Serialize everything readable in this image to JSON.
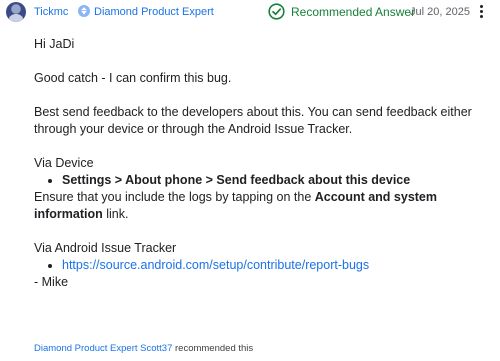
{
  "header": {
    "username": "Tickmc",
    "badge_label": "Diamond Product Expert",
    "status_label": "Recommended Answer",
    "date": "Jul 20, 2025",
    "more_icon": "more-vertical-icon",
    "status_color": "#188038",
    "link_color": "#1a73e8"
  },
  "post": {
    "greeting": "Hi JaDi",
    "confirm": "Good catch - I can confirm this bug.",
    "advice": "Best send feedback to the developers about this. You can send feedback either through your device or through the Android Issue Tracker.",
    "via_device_heading": "Via Device",
    "device_step": "Settings > About phone > Send feedback about this device",
    "ensure_prefix": "Ensure that you include the logs by tapping on the ",
    "ensure_bold": "Account and system information",
    "ensure_suffix": " link.",
    "via_tracker_heading": "Via Android Issue Tracker",
    "tracker_link": "https://source.android.com/setup/contribute/report-bugs",
    "signature": "- Mike"
  },
  "footer": {
    "recommender_link": "Diamond Product Expert Scott37",
    "recommended_text": " recommended this"
  }
}
